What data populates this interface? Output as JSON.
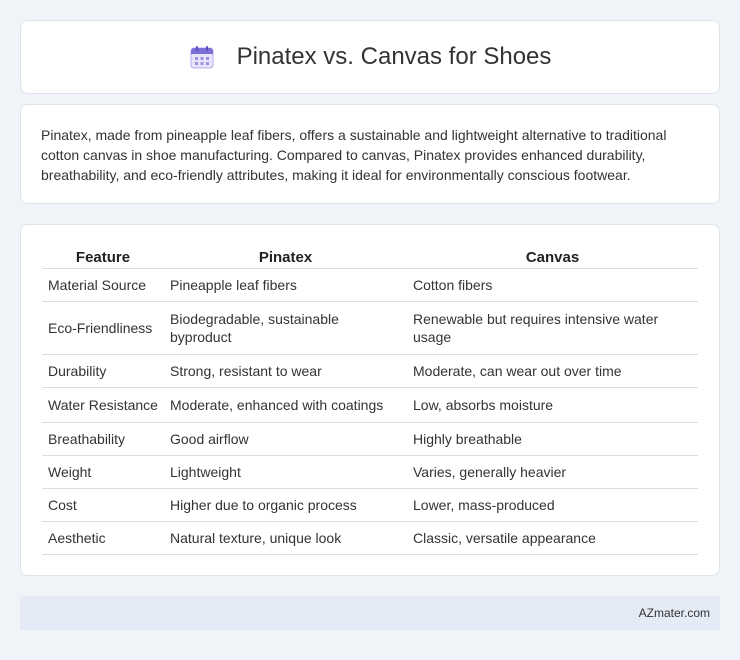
{
  "header": {
    "title": "Pinatex vs. Canvas for Shoes",
    "icon": "calendar-icon",
    "icon_color": "#7b6fd6"
  },
  "intro": {
    "text": "Pinatex, made from pineapple leaf fibers, offers a sustainable and lightweight alternative to traditional cotton canvas in shoe manufacturing. Compared to canvas, Pinatex provides enhanced durability, breathability, and eco-friendly attributes, making it ideal for environmentally conscious footwear."
  },
  "table": {
    "headers": [
      "Feature",
      "Pinatex",
      "Canvas"
    ],
    "rows": [
      [
        "Material Source",
        "Pineapple leaf fibers",
        "Cotton fibers"
      ],
      [
        "Eco-Friendliness",
        "Biodegradable, sustainable byproduct",
        "Renewable but requires intensive water usage"
      ],
      [
        "Durability",
        "Strong, resistant to wear",
        "Moderate, can wear out over time"
      ],
      [
        "Water Resistance",
        "Moderate, enhanced with coatings",
        "Low, absorbs moisture"
      ],
      [
        "Breathability",
        "Good airflow",
        "Highly breathable"
      ],
      [
        "Weight",
        "Lightweight",
        "Varies, generally heavier"
      ],
      [
        "Cost",
        "Higher due to organic process",
        "Lower, mass-produced"
      ],
      [
        "Aesthetic",
        "Natural texture, unique look",
        "Classic, versatile appearance"
      ]
    ]
  },
  "footer": {
    "brand": "AZmater.com"
  }
}
